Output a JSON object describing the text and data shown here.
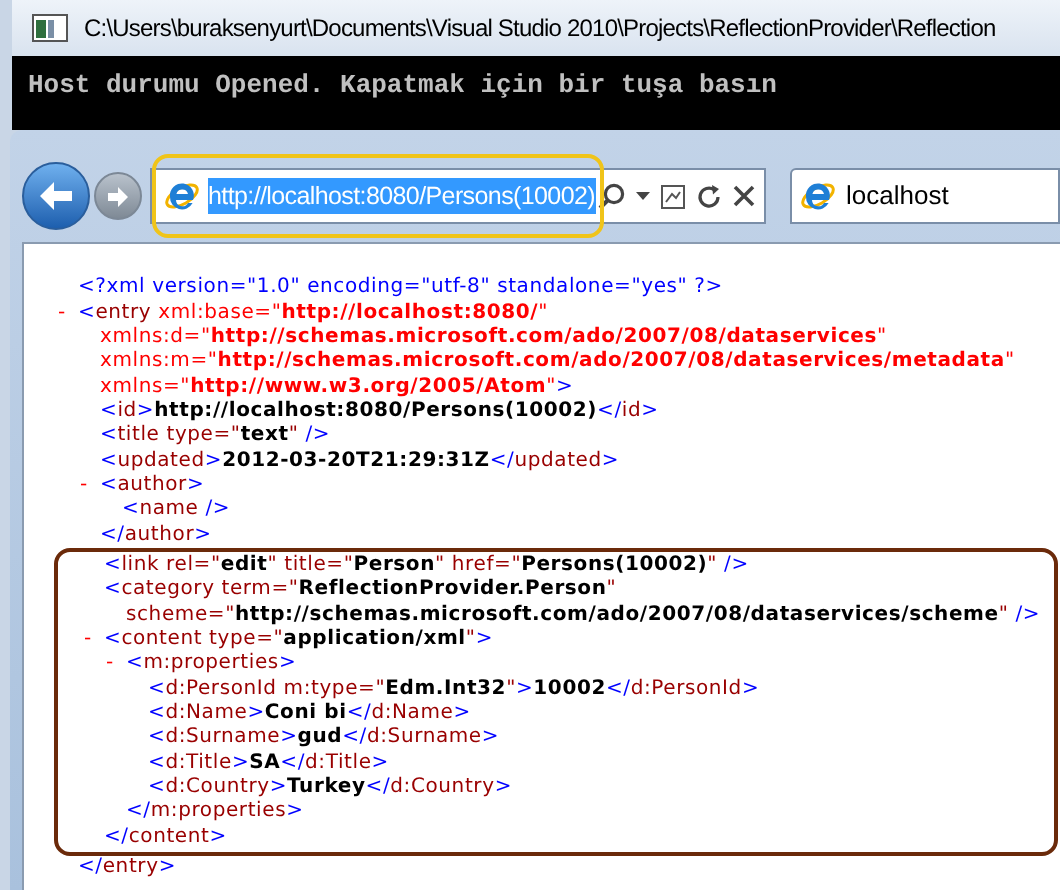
{
  "console": {
    "title": "C:\\Users\\buraksenyurt\\Documents\\Visual Studio 2010\\Projects\\ReflectionProvider\\Reflection",
    "output": "Host durumu Opened. Kapatmak için bir tuşa basın"
  },
  "browser": {
    "forward_disabled": true,
    "address": {
      "url": "http://localhost:8080/Persons(10002)",
      "selected": true,
      "highlighted": true
    },
    "tab": {
      "title": "localhost"
    }
  },
  "document": {
    "lines": [
      {
        "parts": [
          {
            "kind": "punct",
            "text": "<?xml version=\"1.0\" encoding=\"utf-8\" standalone=\"yes\" ?>"
          }
        ]
      },
      {
        "toggle": "-",
        "parts": [
          {
            "kind": "punct",
            "text": "<"
          },
          {
            "kind": "tag",
            "text": "entry"
          },
          {
            "kind": "ns",
            "text": " xml:base=\""
          },
          {
            "kind": "nsvalue",
            "text": "http://localhost:8080/"
          },
          {
            "kind": "ns",
            "text": "\""
          }
        ],
        "children": [
          {
            "parts": [
              {
                "kind": "ns",
                "text": "xmlns:d=\""
              },
              {
                "kind": "nsvalue",
                "text": "http://schemas.microsoft.com/ado/2007/08/dataservices"
              },
              {
                "kind": "ns",
                "text": "\""
              }
            ]
          },
          {
            "parts": [
              {
                "kind": "ns",
                "text": "xmlns:m=\""
              },
              {
                "kind": "nsvalue",
                "text": "http://schemas.microsoft.com/ado/2007/08/dataservices/metadata"
              },
              {
                "kind": "ns",
                "text": "\""
              }
            ]
          },
          {
            "parts": [
              {
                "kind": "ns",
                "text": "xmlns=\""
              },
              {
                "kind": "nsvalue",
                "text": "http://www.w3.org/2005/Atom"
              },
              {
                "kind": "ns",
                "text": "\""
              },
              {
                "kind": "punct",
                "text": ">"
              }
            ]
          },
          {
            "parts": [
              {
                "kind": "punct",
                "text": "<"
              },
              {
                "kind": "tag",
                "text": "id"
              },
              {
                "kind": "punct",
                "text": ">"
              },
              {
                "kind": "value",
                "text": "http://localhost:8080/Persons(10002)"
              },
              {
                "kind": "punct",
                "text": "</"
              },
              {
                "kind": "tag",
                "text": "id"
              },
              {
                "kind": "punct",
                "text": ">"
              }
            ]
          },
          {
            "parts": [
              {
                "kind": "punct",
                "text": "<"
              },
              {
                "kind": "tag",
                "text": "title type=\""
              },
              {
                "kind": "value",
                "text": "text"
              },
              {
                "kind": "tag",
                "text": "\""
              },
              {
                "kind": "punct",
                "text": " />"
              }
            ]
          },
          {
            "parts": [
              {
                "kind": "punct",
                "text": "<"
              },
              {
                "kind": "tag",
                "text": "updated"
              },
              {
                "kind": "punct",
                "text": ">"
              },
              {
                "kind": "value",
                "text": "2012-03-20T21:29:31Z"
              },
              {
                "kind": "punct",
                "text": "</"
              },
              {
                "kind": "tag",
                "text": "updated"
              },
              {
                "kind": "punct",
                "text": ">"
              }
            ]
          },
          {
            "toggle": "-",
            "parts": [
              {
                "kind": "punct",
                "text": "<"
              },
              {
                "kind": "tag",
                "text": "author"
              },
              {
                "kind": "punct",
                "text": ">"
              }
            ],
            "children": [
              {
                "parts": [
                  {
                    "kind": "punct",
                    "text": "<"
                  },
                  {
                    "kind": "tag",
                    "text": "name"
                  },
                  {
                    "kind": "punct",
                    "text": " />"
                  }
                ]
              }
            ],
            "close": [
              {
                "kind": "punct",
                "text": "</"
              },
              {
                "kind": "tag",
                "text": "author"
              },
              {
                "kind": "punct",
                "text": ">"
              }
            ]
          },
          {
            "boxed": true,
            "parts": [
              {
                "kind": "punct",
                "text": "<"
              },
              {
                "kind": "tag",
                "text": "link rel=\""
              },
              {
                "kind": "value",
                "text": "edit"
              },
              {
                "kind": "tag",
                "text": "\" title=\""
              },
              {
                "kind": "value",
                "text": "Person"
              },
              {
                "kind": "tag",
                "text": "\" href=\""
              },
              {
                "kind": "value",
                "text": "Persons(10002)"
              },
              {
                "kind": "tag",
                "text": "\""
              },
              {
                "kind": "punct",
                "text": " />"
              }
            ]
          },
          {
            "boxed": true,
            "parts": [
              {
                "kind": "punct",
                "text": "<"
              },
              {
                "kind": "tag",
                "text": "category term=\""
              },
              {
                "kind": "value",
                "text": "ReflectionProvider.Person"
              },
              {
                "kind": "tag",
                "text": "\""
              }
            ],
            "children": [
              {
                "parts": [
                  {
                    "kind": "tag",
                    "text": "scheme=\""
                  },
                  {
                    "kind": "value",
                    "text": "http://schemas.microsoft.com/ado/2007/08/dataservices/scheme"
                  },
                  {
                    "kind": "tag",
                    "text": "\""
                  },
                  {
                    "kind": "punct",
                    "text": " />"
                  }
                ]
              }
            ]
          },
          {
            "boxed": true,
            "toggle": "-",
            "parts": [
              {
                "kind": "punct",
                "text": "<"
              },
              {
                "kind": "tag",
                "text": "content type=\""
              },
              {
                "kind": "value",
                "text": "application/xml"
              },
              {
                "kind": "tag",
                "text": "\""
              },
              {
                "kind": "punct",
                "text": ">"
              }
            ],
            "children": [
              {
                "toggle": "-",
                "parts": [
                  {
                    "kind": "punct",
                    "text": "<"
                  },
                  {
                    "kind": "tag",
                    "text": "m:properties"
                  },
                  {
                    "kind": "punct",
                    "text": ">"
                  }
                ],
                "children": [
                  {
                    "parts": [
                      {
                        "kind": "punct",
                        "text": "<"
                      },
                      {
                        "kind": "tag",
                        "text": "d:PersonId m:type=\""
                      },
                      {
                        "kind": "value",
                        "text": "Edm.Int32"
                      },
                      {
                        "kind": "tag",
                        "text": "\""
                      },
                      {
                        "kind": "punct",
                        "text": ">"
                      },
                      {
                        "kind": "value",
                        "text": "10002"
                      },
                      {
                        "kind": "punct",
                        "text": "</"
                      },
                      {
                        "kind": "tag",
                        "text": "d:PersonId"
                      },
                      {
                        "kind": "punct",
                        "text": ">"
                      }
                    ]
                  },
                  {
                    "parts": [
                      {
                        "kind": "punct",
                        "text": "<"
                      },
                      {
                        "kind": "tag",
                        "text": "d:Name"
                      },
                      {
                        "kind": "punct",
                        "text": ">"
                      },
                      {
                        "kind": "value",
                        "text": "Coni bi"
                      },
                      {
                        "kind": "punct",
                        "text": "</"
                      },
                      {
                        "kind": "tag",
                        "text": "d:Name"
                      },
                      {
                        "kind": "punct",
                        "text": ">"
                      }
                    ]
                  },
                  {
                    "parts": [
                      {
                        "kind": "punct",
                        "text": "<"
                      },
                      {
                        "kind": "tag",
                        "text": "d:Surname"
                      },
                      {
                        "kind": "punct",
                        "text": ">"
                      },
                      {
                        "kind": "value",
                        "text": "gud"
                      },
                      {
                        "kind": "punct",
                        "text": "</"
                      },
                      {
                        "kind": "tag",
                        "text": "d:Surname"
                      },
                      {
                        "kind": "punct",
                        "text": ">"
                      }
                    ]
                  },
                  {
                    "parts": [
                      {
                        "kind": "punct",
                        "text": "<"
                      },
                      {
                        "kind": "tag",
                        "text": "d:Title"
                      },
                      {
                        "kind": "punct",
                        "text": ">"
                      },
                      {
                        "kind": "value",
                        "text": "SA"
                      },
                      {
                        "kind": "punct",
                        "text": "</"
                      },
                      {
                        "kind": "tag",
                        "text": "d:Title"
                      },
                      {
                        "kind": "punct",
                        "text": ">"
                      }
                    ]
                  },
                  {
                    "parts": [
                      {
                        "kind": "punct",
                        "text": "<"
                      },
                      {
                        "kind": "tag",
                        "text": "d:Country"
                      },
                      {
                        "kind": "punct",
                        "text": ">"
                      },
                      {
                        "kind": "value",
                        "text": "Turkey"
                      },
                      {
                        "kind": "punct",
                        "text": "</"
                      },
                      {
                        "kind": "tag",
                        "text": "d:Country"
                      },
                      {
                        "kind": "punct",
                        "text": ">"
                      }
                    ]
                  }
                ],
                "close": [
                  {
                    "kind": "punct",
                    "text": "</"
                  },
                  {
                    "kind": "tag",
                    "text": "m:properties"
                  },
                  {
                    "kind": "punct",
                    "text": ">"
                  }
                ]
              }
            ],
            "close": [
              {
                "kind": "punct",
                "text": "</"
              },
              {
                "kind": "tag",
                "text": "content"
              },
              {
                "kind": "punct",
                "text": ">"
              }
            ]
          }
        ],
        "close": [
          {
            "kind": "punct",
            "text": "</"
          },
          {
            "kind": "tag",
            "text": "entry"
          },
          {
            "kind": "punct",
            "text": ">"
          }
        ]
      }
    ]
  }
}
